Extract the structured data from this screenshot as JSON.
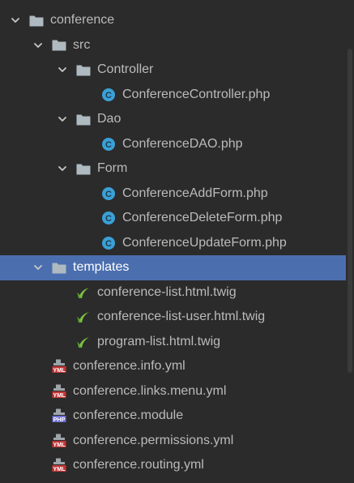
{
  "tree": {
    "items": [
      {
        "label": "conference",
        "icon": "folder-icon",
        "depth": 0,
        "expanded": true
      },
      {
        "label": "src",
        "icon": "folder-icon",
        "depth": 1,
        "expanded": true
      },
      {
        "label": "Controller",
        "icon": "folder-icon",
        "depth": 2,
        "expanded": true
      },
      {
        "label": "ConferenceController.php",
        "icon": "php-class-icon",
        "depth": 3
      },
      {
        "label": "Dao",
        "icon": "folder-icon",
        "depth": 2,
        "expanded": true
      },
      {
        "label": "ConferenceDAO.php",
        "icon": "php-class-icon",
        "depth": 3
      },
      {
        "label": "Form",
        "icon": "folder-icon",
        "depth": 2,
        "expanded": true
      },
      {
        "label": "ConferenceAddForm.php",
        "icon": "php-class-icon",
        "depth": 3
      },
      {
        "label": "ConferenceDeleteForm.php",
        "icon": "php-class-icon",
        "depth": 3
      },
      {
        "label": "ConferenceUpdateForm.php",
        "icon": "php-class-icon",
        "depth": 3
      },
      {
        "label": "templates",
        "icon": "folder-icon",
        "depth": 1,
        "expanded": true,
        "selected": true
      },
      {
        "label": "conference-list.html.twig",
        "icon": "twig-icon",
        "depth": 2
      },
      {
        "label": "conference-list-user.html.twig",
        "icon": "twig-icon",
        "depth": 2
      },
      {
        "label": "program-list.html.twig",
        "icon": "twig-icon",
        "depth": 2
      },
      {
        "label": "conference.info.yml",
        "icon": "yml-file-icon",
        "depth": 1
      },
      {
        "label": "conference.links.menu.yml",
        "icon": "yml-file-icon",
        "depth": 1
      },
      {
        "label": "conference.module",
        "icon": "php-file-icon",
        "depth": 1
      },
      {
        "label": "conference.permissions.yml",
        "icon": "yml-file-icon",
        "depth": 1
      },
      {
        "label": "conference.routing.yml",
        "icon": "yml-file-icon",
        "depth": 1
      }
    ]
  },
  "icon_text": {
    "php_class": "C",
    "yml": "YML",
    "php": "PHP"
  },
  "colors": {
    "background": "#2b2b2b",
    "selection": "#4b6eaf",
    "text": "#bbbbbb",
    "folder": "#aeb9c0",
    "php_class": "#3aa0d8",
    "twig": "#7cc242",
    "yml_badge": "#c63535",
    "php_badge": "#6e6fcf"
  }
}
